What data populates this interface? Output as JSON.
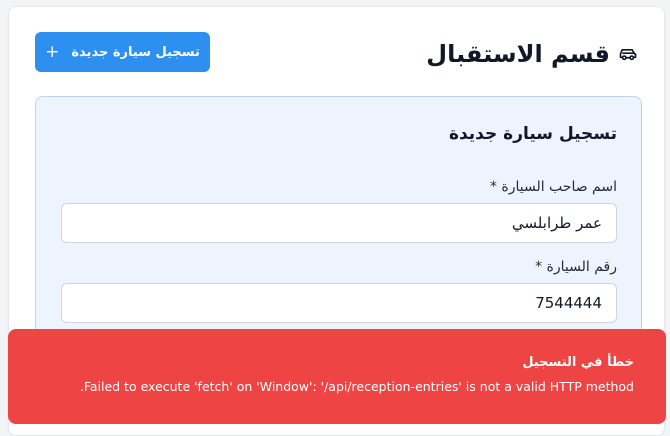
{
  "header": {
    "title": "قسم الاستقبال",
    "title_icon": "car-icon",
    "new_button_label": "تسجيل سيارة جديدة",
    "new_button_icon": "plus-icon",
    "accent_color": "#2d8ff0"
  },
  "form": {
    "title": "تسجيل سيارة جديدة",
    "fields": [
      {
        "label": "اسم صاحب السيارة *",
        "value": "عمر طرابلسي"
      },
      {
        "label": "رقم السيارة *",
        "value": "7544444"
      }
    ]
  },
  "toast": {
    "title": "خطأ في التسجيل",
    "message": "Failed to execute 'fetch' on 'Window': '/api/reception-entries' is not a valid HTTP method.",
    "color": "#ef4444"
  }
}
